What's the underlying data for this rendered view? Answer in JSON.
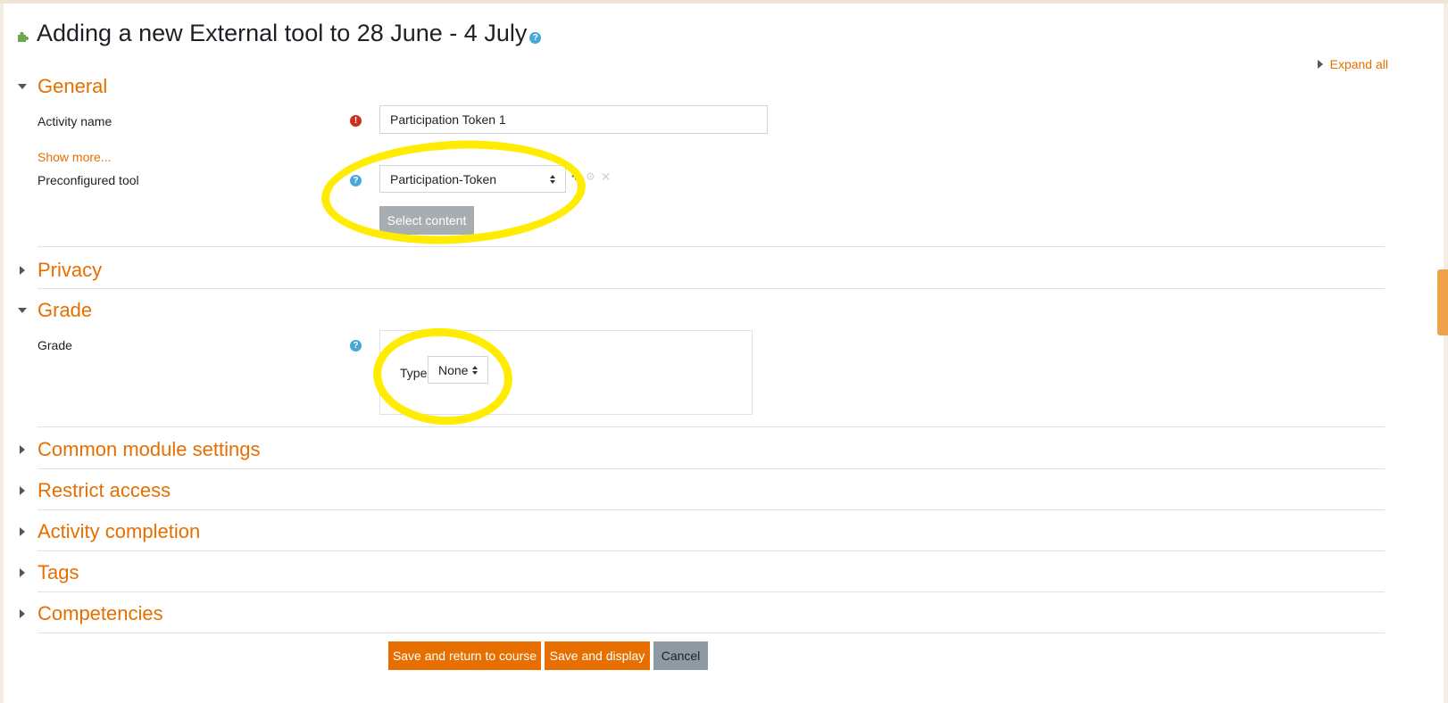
{
  "page": {
    "title": "Adding a new External tool to 28 June - 4 July",
    "expand_all": "Expand all"
  },
  "general": {
    "heading": "General",
    "activity_name_label": "Activity name",
    "activity_name_value": "Participation Token 1",
    "show_more": "Show more...",
    "preconfigured_tool_label": "Preconfigured tool",
    "preconfigured_tool_value": "Participation-Token",
    "select_content": "Select content"
  },
  "privacy": {
    "heading": "Privacy"
  },
  "grade": {
    "heading": "Grade",
    "grade_label": "Grade",
    "type_label": "Type",
    "type_value": "None"
  },
  "collapsed_sections": [
    "Common module settings",
    "Restrict access",
    "Activity completion",
    "Tags",
    "Competencies"
  ],
  "buttons": {
    "save_return": "Save and return to course",
    "save_display": "Save and display",
    "cancel": "Cancel"
  },
  "colors": {
    "accent": "#e66f00",
    "highlight": "#ffec00",
    "help": "#46a7d9",
    "required": "#ca3120"
  },
  "icons": [
    "puzzle-icon",
    "help-icon",
    "required-icon",
    "plus-icon",
    "gear-icon",
    "close-icon"
  ]
}
